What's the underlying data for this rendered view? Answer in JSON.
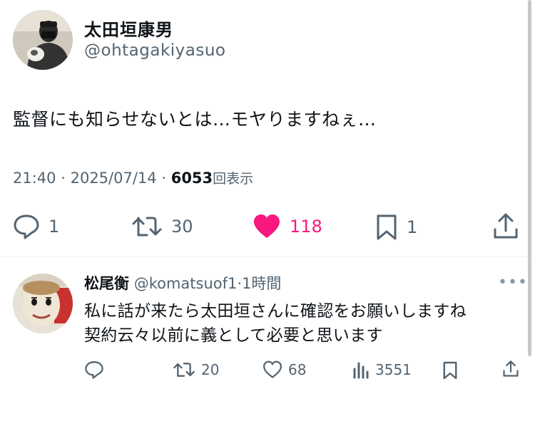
{
  "tweet": {
    "author_name": "太田垣康男",
    "author_handle": "@ohtagakiyasuo",
    "text": "監督にも知らせないとは…モヤりますねぇ…",
    "time": "21:40",
    "date": "2025/07/14",
    "separator": "·",
    "views": "6053",
    "views_label": "回表示",
    "actions": {
      "replies": "1",
      "retweets": "30",
      "likes": "118",
      "bookmarks": "1"
    },
    "colors": {
      "like": "#f91880",
      "muted": "#536471"
    }
  },
  "reply": {
    "author_name": "松尾衡",
    "author_handle": "@komatsuof1",
    "time_ago": "1時間",
    "line1": "私に話が来たら太田垣さんに確認をお願いしますね",
    "line2": "契約云々以前に義として必要と思います",
    "actions": {
      "retweets": "20",
      "likes": "68",
      "views": "3551"
    }
  },
  "icons": [
    "reply-icon",
    "retweet-icon",
    "heart-icon",
    "bookmark-icon",
    "share-icon",
    "views-icon",
    "more-icon"
  ]
}
